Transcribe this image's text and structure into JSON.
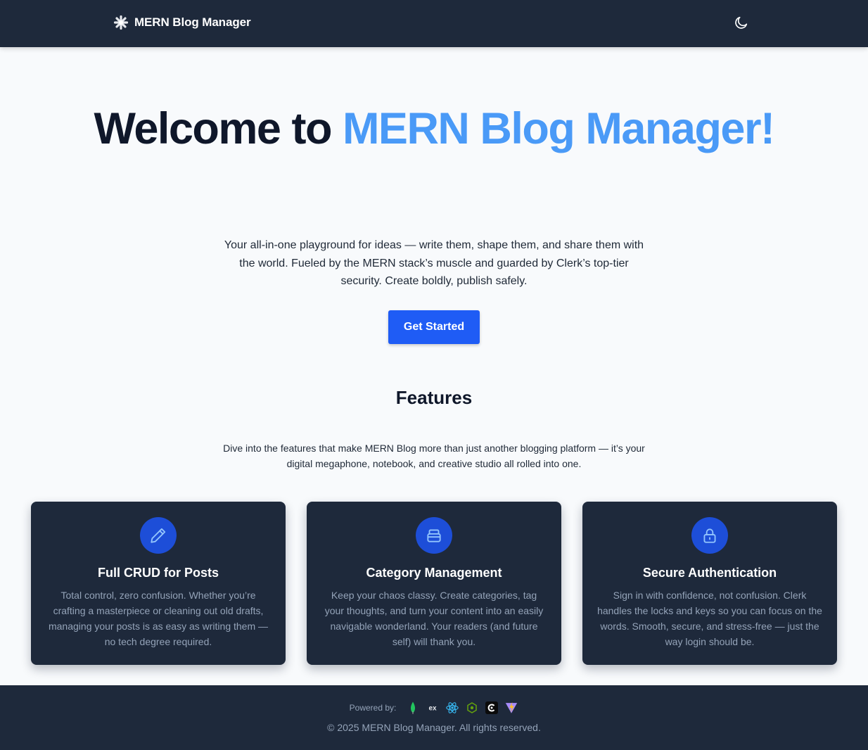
{
  "navbar": {
    "brand_icon": "asterisk-flower-icon",
    "brand_name": "MERN Blog Manager",
    "theme_toggle_icon": "moon-icon"
  },
  "hero": {
    "title_prefix": "Welcome to ",
    "title_accent": "MERN Blog Manager!",
    "description": "Your all-in-one playground for ideas — write them, shape them, and share them with the world. Fueled by the MERN stack’s muscle and guarded by Clerk’s top-tier security. Create boldly, publish safely.",
    "cta_label": "Get Started"
  },
  "features": {
    "heading": "Features",
    "description": "Dive into the features that make MERN Blog more than just another blogging platform — it’s your digital megaphone, notebook, and creative studio all rolled into one.",
    "cards": [
      {
        "icon": "pencil-icon",
        "title": "Full CRUD for Posts",
        "description": "Total control, zero confusion. Whether you’re crafting a masterpiece or cleaning out old drafts, managing your posts is as easy as writing them — no tech degree required."
      },
      {
        "icon": "archive-box-icon",
        "title": "Category Management",
        "description": "Keep your chaos classy. Create categories, tag your thoughts, and turn your content into an easily navigable wonderland. Your readers (and future self) will thank you."
      },
      {
        "icon": "lock-icon",
        "title": "Secure Authentication",
        "description": "Sign in with confidence, not confusion. Clerk handles the locks and keys so you can focus on the words. Smooth, secure, and stress-free — just the way login should be."
      }
    ]
  },
  "footer": {
    "powered_label": "Powered by:",
    "tech_icons": [
      "mongodb-icon",
      "express-icon",
      "react-icon",
      "nodejs-icon",
      "clerk-icon",
      "vite-icon"
    ],
    "express_text": "ex",
    "copyright": "© 2025 MERN Blog Manager. All rights reserved."
  },
  "colors": {
    "navbar_bg": "#1e293b",
    "page_bg": "#f8fafc",
    "accent": "#4a9af7",
    "button": "#1f5cf5",
    "card_bg": "#1e293b",
    "icon_circle": "#1d4ed8"
  }
}
